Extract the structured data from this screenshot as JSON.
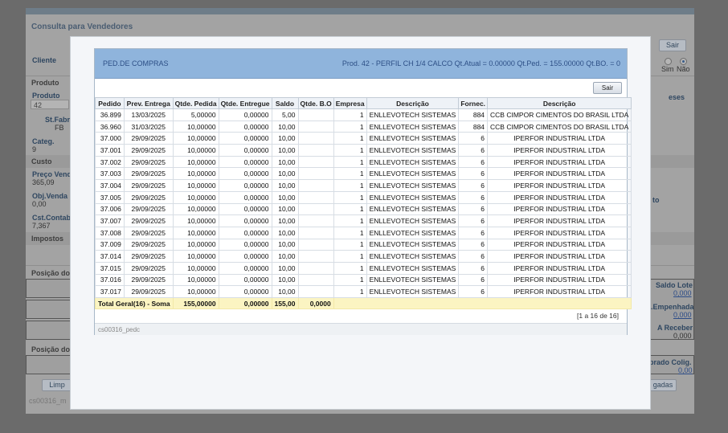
{
  "background": {
    "title": "Consulta para Vendedores",
    "sair_label": "Sair",
    "cliente_label": "Cliente",
    "radio_sim": "Sim",
    "radio_nao": "Não",
    "produto_section": "Produto",
    "produto_label": "Produto",
    "produto_value": "42",
    "stfabri_label": "St.Fabri",
    "stfabri_value": "FB",
    "categ_label": "Categ.",
    "categ_value": "9",
    "custo_section": "Custo",
    "preco_label": "Preço Vend",
    "preco_value": "365,09",
    "objvenda_label": "Obj.Venda",
    "objvenda_value": "0,00",
    "cstcontab_label": "Cst.Contab.",
    "cstcontab_value": "7,367",
    "impostos_section": "Impostos",
    "posicao1_label": "Posição do",
    "posicao2_label": "Posição do",
    "right_partial1": "eses",
    "right_partial2": "to",
    "saldo_lote_label": "Saldo Lote",
    "saldo_lote_value": "0,000",
    "empenhada_label": ".Empenhada",
    "empenhada_value": "0,000",
    "areceber_label": "A Receber",
    "areceber_value": "0,000",
    "comprado_label": "prado Colig.",
    "comprado_value": "0,00",
    "limpar_partial": "Limp",
    "gadas_partial": "gadas",
    "footer_code": "cs00316_m"
  },
  "modal": {
    "title": "PED.DE COMPRAS",
    "info": "Prod. 42 - PERFIL CH 1/4 CALCO Qt.Atual = 0.00000 Qt.Ped. = 155.00000 Qt.BO. = 0",
    "sair_label": "Sair",
    "columns": [
      "Pedido",
      "Prev. Entrega",
      "Qtde. Pedida",
      "Qtde. Entregue",
      "Saldo",
      "Qtde. B.O",
      "Empresa",
      "Descrição",
      "Fornec.",
      "Descrição"
    ],
    "rows": [
      [
        "36.899",
        "13/03/2025",
        "5,00000",
        "0,00000",
        "5,00",
        "",
        "1",
        "ENLLEVOTECH SISTEMAS",
        "884",
        "CCB CIMPOR CIMENTOS DO BRASIL LTDA"
      ],
      [
        "36.960",
        "31/03/2025",
        "10,00000",
        "0,00000",
        "10,00",
        "",
        "1",
        "ENLLEVOTECH SISTEMAS",
        "884",
        "CCB CIMPOR CIMENTOS DO BRASIL LTDA"
      ],
      [
        "37.000",
        "29/09/2025",
        "10,00000",
        "0,00000",
        "10,00",
        "",
        "1",
        "ENLLEVOTECH SISTEMAS",
        "6",
        "IPERFOR INDUSTRIAL LTDA"
      ],
      [
        "37.001",
        "29/09/2025",
        "10,00000",
        "0,00000",
        "10,00",
        "",
        "1",
        "ENLLEVOTECH SISTEMAS",
        "6",
        "IPERFOR INDUSTRIAL LTDA"
      ],
      [
        "37.002",
        "29/09/2025",
        "10,00000",
        "0,00000",
        "10,00",
        "",
        "1",
        "ENLLEVOTECH SISTEMAS",
        "6",
        "IPERFOR INDUSTRIAL LTDA"
      ],
      [
        "37.003",
        "29/09/2025",
        "10,00000",
        "0,00000",
        "10,00",
        "",
        "1",
        "ENLLEVOTECH SISTEMAS",
        "6",
        "IPERFOR INDUSTRIAL LTDA"
      ],
      [
        "37.004",
        "29/09/2025",
        "10,00000",
        "0,00000",
        "10,00",
        "",
        "1",
        "ENLLEVOTECH SISTEMAS",
        "6",
        "IPERFOR INDUSTRIAL LTDA"
      ],
      [
        "37.005",
        "29/09/2025",
        "10,00000",
        "0,00000",
        "10,00",
        "",
        "1",
        "ENLLEVOTECH SISTEMAS",
        "6",
        "IPERFOR INDUSTRIAL LTDA"
      ],
      [
        "37.006",
        "29/09/2025",
        "10,00000",
        "0,00000",
        "10,00",
        "",
        "1",
        "ENLLEVOTECH SISTEMAS",
        "6",
        "IPERFOR INDUSTRIAL LTDA"
      ],
      [
        "37.007",
        "29/09/2025",
        "10,00000",
        "0,00000",
        "10,00",
        "",
        "1",
        "ENLLEVOTECH SISTEMAS",
        "6",
        "IPERFOR INDUSTRIAL LTDA"
      ],
      [
        "37.008",
        "29/09/2025",
        "10,00000",
        "0,00000",
        "10,00",
        "",
        "1",
        "ENLLEVOTECH SISTEMAS",
        "6",
        "IPERFOR INDUSTRIAL LTDA"
      ],
      [
        "37.009",
        "29/09/2025",
        "10,00000",
        "0,00000",
        "10,00",
        "",
        "1",
        "ENLLEVOTECH SISTEMAS",
        "6",
        "IPERFOR INDUSTRIAL LTDA"
      ],
      [
        "37.014",
        "29/09/2025",
        "10,00000",
        "0,00000",
        "10,00",
        "",
        "1",
        "ENLLEVOTECH SISTEMAS",
        "6",
        "IPERFOR INDUSTRIAL LTDA"
      ],
      [
        "37.015",
        "29/09/2025",
        "10,00000",
        "0,00000",
        "10,00",
        "",
        "1",
        "ENLLEVOTECH SISTEMAS",
        "6",
        "IPERFOR INDUSTRIAL LTDA"
      ],
      [
        "37.016",
        "29/09/2025",
        "10,00000",
        "0,00000",
        "10,00",
        "",
        "1",
        "ENLLEVOTECH SISTEMAS",
        "6",
        "IPERFOR INDUSTRIAL LTDA"
      ],
      [
        "37.017",
        "29/09/2025",
        "10,00000",
        "0,00000",
        "10,00",
        "",
        "1",
        "ENLLEVOTECH SISTEMAS",
        "6",
        "IPERFOR INDUSTRIAL LTDA"
      ]
    ],
    "total": {
      "label": "Total Geral(16) - Soma",
      "qtde_pedida": "155,00000",
      "qtde_entregue": "0,00000",
      "saldo": "155,00",
      "qtde_bo": "0,0000"
    },
    "pager": "[1 a 16 de 16]",
    "footer_code": "cs00316_pedc"
  }
}
